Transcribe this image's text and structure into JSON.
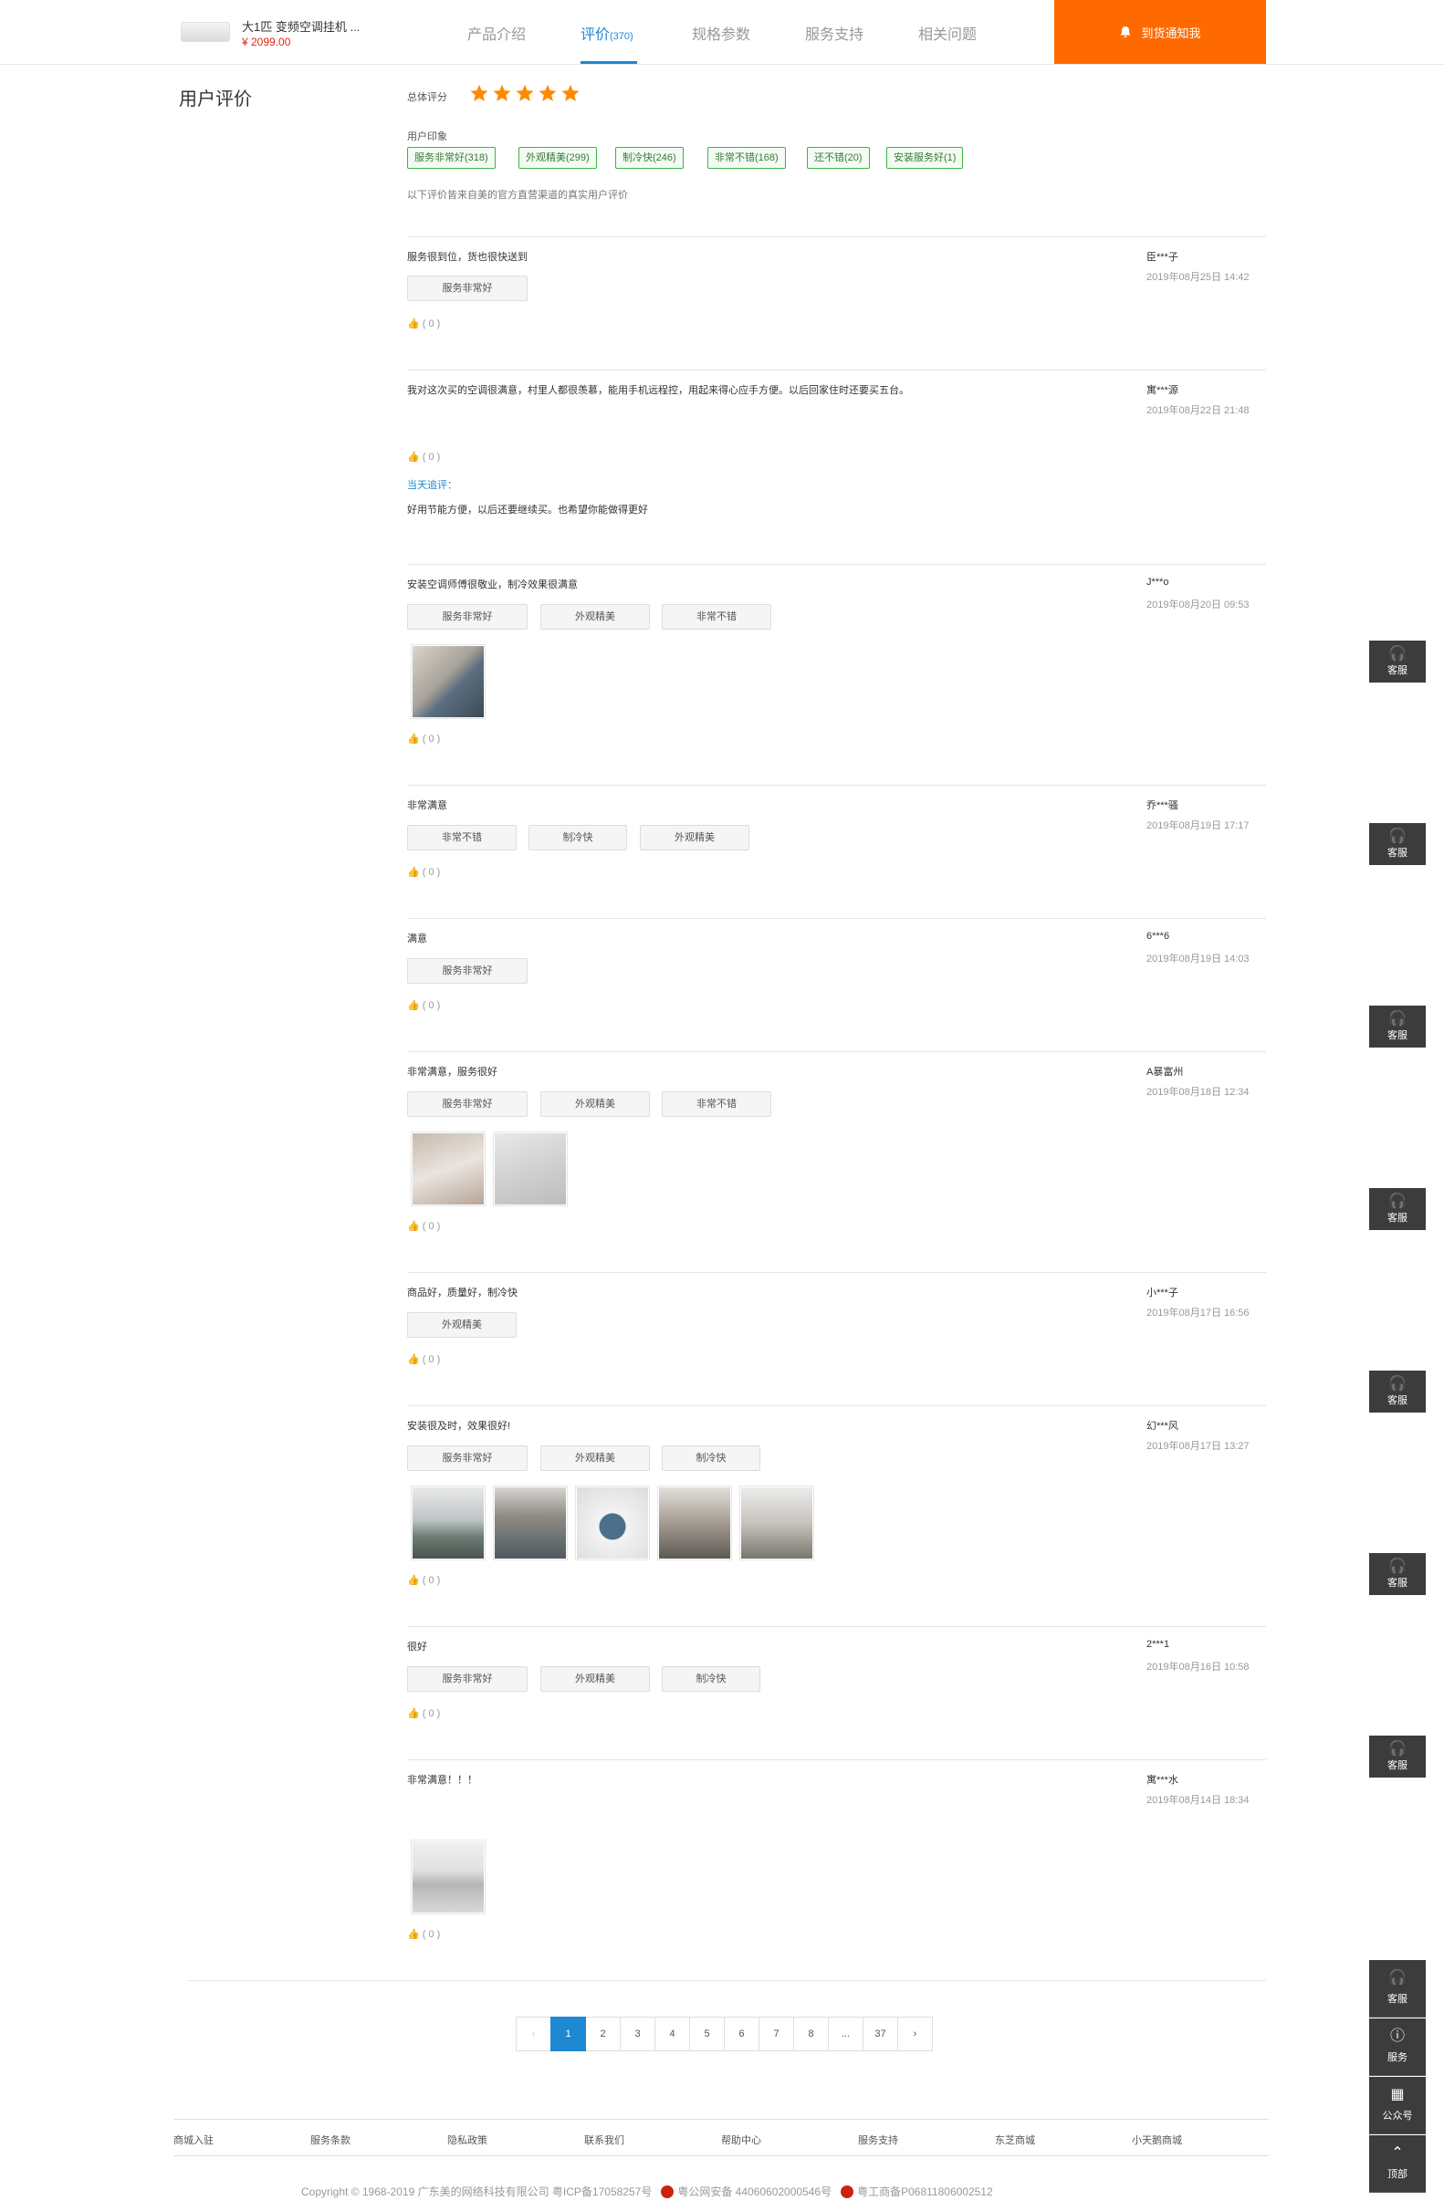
{
  "header": {
    "product_name": "大1匹 变频空调挂机 ...",
    "product_price": "¥ 2099.00",
    "tabs": [
      {
        "label": "产品介绍",
        "count": ""
      },
      {
        "label": "评价",
        "count": "(370)"
      },
      {
        "label": "规格参数",
        "count": ""
      },
      {
        "label": "服务支持",
        "count": ""
      },
      {
        "label": "相关问题",
        "count": ""
      }
    ],
    "notify_label": "到货通知我"
  },
  "summary": {
    "section_title": "用户评价",
    "overall_label": "总体评分",
    "rating": 5,
    "star_color": "#ff8a00",
    "impression_label": "用户印象",
    "impressions": [
      "服务非常好(318)",
      "外观精美(299)",
      "制冷快(246)",
      "非常不错(168)",
      "还不错(20)",
      "安装服务好(1)"
    ],
    "disclaimer": "以下评价皆来自美的官方直营渠道的真实用户评价"
  },
  "reviews": [
    {
      "text": "服务很到位，货也很快送到",
      "user": "臣***子",
      "time": "2019年08月25日 14:42",
      "tags": [
        "服务非常好"
      ],
      "likes": "( 0 )"
    },
    {
      "text": "我对这次买的空调很满意，村里人都很羡慕，能用手机远程控，用起来得心应手方便。以后回家住时还要买五台。",
      "user": "寓***源",
      "time": "2019年08月22日 21:48",
      "tags": [],
      "likes": "( 0 )",
      "reply_label": "当天追评：",
      "reply_text": "好用节能方便，以后还要继续买。也希望你能做得更好"
    },
    {
      "text": "安装空调师傅很敬业，制冷效果很满意",
      "user": "J***o",
      "time": "2019年08月20日 09:53",
      "tags": [
        "服务非常好",
        "外观精美",
        "非常不错"
      ],
      "likes": "( 0 )"
    },
    {
      "text": "非常满意",
      "user": "乔***骚",
      "time": "2019年08月19日 17:17",
      "tags": [
        "非常不错",
        "制冷快",
        "外观精美"
      ],
      "likes": "( 0 )"
    },
    {
      "text": "满意",
      "user": "6***6",
      "time": "2019年08月19日 14:03",
      "tags": [
        "服务非常好"
      ],
      "likes": "( 0 )"
    },
    {
      "text": "非常满意，服务很好",
      "user": "A暴富州",
      "time": "2019年08月18日 12:34",
      "tags": [
        "服务非常好",
        "外观精美",
        "非常不错"
      ],
      "likes": "( 0 )"
    },
    {
      "text": "商品好，质量好，制冷快",
      "user": "小***子",
      "time": "2019年08月17日 16:56",
      "tags": [
        "外观精美"
      ],
      "likes": "( 0 )"
    },
    {
      "text": "安装很及时，效果很好!",
      "user": "幻***风",
      "time": "2019年08月17日 13:27",
      "tags": [
        "服务非常好",
        "外观精美",
        "制冷快"
      ],
      "likes": "( 0 )"
    },
    {
      "text": "很好",
      "user": "2***1",
      "time": "2019年08月16日 10:58",
      "tags": [
        "服务非常好",
        "外观精美",
        "制冷快"
      ],
      "likes": "( 0 )"
    },
    {
      "text": "非常满意！！！",
      "user": "寓***水",
      "time": "2019年08月14日 18:34",
      "tags": [],
      "likes": "( 0 )"
    }
  ],
  "pagination": {
    "pages": [
      "1",
      "2",
      "3",
      "4",
      "5",
      "6",
      "7",
      "8",
      "...",
      "37"
    ],
    "current": "1",
    "prev_icon": "chevron-left-icon",
    "next_icon": "chevron-right-icon"
  },
  "footer": {
    "links": [
      "商城入驻",
      "服务条款",
      "隐私政策",
      "联系我们",
      "帮助中心",
      "服务支持",
      "东芝商城",
      "小天鹅商城"
    ],
    "copyright": "Copyright © 1968-2019 广东美的网络科技有限公司 粤ICP备17058257号",
    "police_record": "粤公网安备 44060602000546号",
    "business_record": "粤工商备P06811806002512"
  },
  "float_service": {
    "kefu_label": "客服",
    "side": [
      {
        "icon": "headset-icon",
        "label": "客服"
      },
      {
        "icon": "info-icon",
        "label": "服务"
      },
      {
        "icon": "qrcode-icon",
        "label": "公众号"
      },
      {
        "icon": "chevron-up-icon",
        "label": "顶部"
      }
    ]
  }
}
